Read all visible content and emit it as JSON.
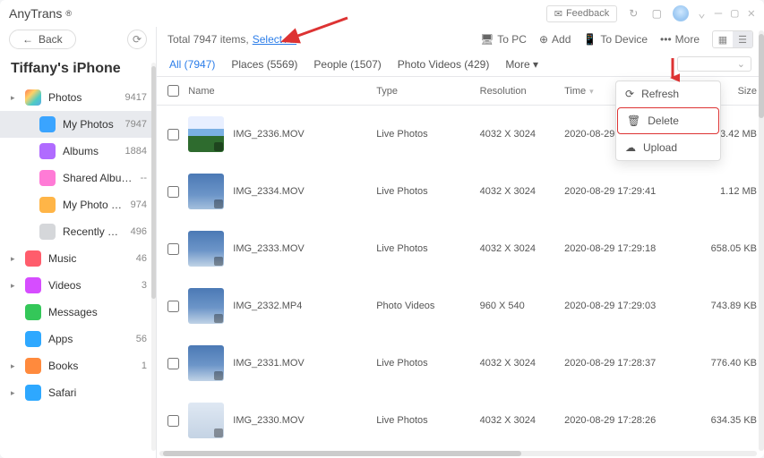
{
  "app": {
    "name": "AnyTrans",
    "reg": "®"
  },
  "titlebar": {
    "feedback": "Feedback"
  },
  "sidebar": {
    "back": "Back",
    "device": "Tiffany's iPhone",
    "items": [
      {
        "label": "Photos",
        "count": "9417",
        "caret": true,
        "icon_bg": "linear-gradient(135deg,#ff7b54,#ffd166,#4ecdc4,#5aa9e6)"
      },
      {
        "label": "My Photos",
        "count": "7947",
        "child": true,
        "selected": true,
        "icon_bg": "#3aa4ff"
      },
      {
        "label": "Albums",
        "count": "1884",
        "child": true,
        "icon_bg": "#b06bff"
      },
      {
        "label": "Shared Albums",
        "count": "--",
        "child": true,
        "icon_bg": "#ff7bd6"
      },
      {
        "label": "My Photo Stream",
        "count": "974",
        "child": true,
        "icon_bg": "#ffb547"
      },
      {
        "label": "Recently Deleted",
        "count": "496",
        "child": true,
        "icon_bg": "#d5d7da"
      },
      {
        "label": "Music",
        "count": "46",
        "caret": true,
        "icon_bg": "#ff5d6c"
      },
      {
        "label": "Videos",
        "count": "3",
        "caret": true,
        "icon_bg": "#d64dff"
      },
      {
        "label": "Messages",
        "count": "",
        "icon_bg": "#34c759"
      },
      {
        "label": "Apps",
        "count": "56",
        "icon_bg": "#2ea8ff"
      },
      {
        "label": "Books",
        "count": "1",
        "caret": true,
        "icon_bg": "#ff8a3d"
      },
      {
        "label": "Safari",
        "count": "",
        "caret": true,
        "icon_bg": "#2ea8ff"
      }
    ]
  },
  "toolbar": {
    "total_pre": "Total 7947 items, ",
    "select_all": "Select All",
    "to_pc": "To PC",
    "add": "Add",
    "to_device": "To Device",
    "more": "More"
  },
  "tabs": [
    {
      "label": "All",
      "count": "(7947)",
      "active": true
    },
    {
      "label": "Places",
      "count": "(5569)"
    },
    {
      "label": "People",
      "count": "(1507)"
    },
    {
      "label": "Photo Videos",
      "count": "(429)"
    },
    {
      "label": "More",
      "count": "▾"
    }
  ],
  "columns": {
    "name": "Name",
    "type": "Type",
    "resolution": "Resolution",
    "time": "Time",
    "size": "Size"
  },
  "rows": [
    {
      "name": "IMG_2336.MOV",
      "type": "Live Photos",
      "res": "4032 X 3024",
      "time": "2020-08-29 18:24:41",
      "size": "3.42 MB",
      "thumb": "linear-gradient(#e8efff 0 35%, #7bb0e3 35% 55%, #2e6b2e 55% 100%)"
    },
    {
      "name": "IMG_2334.MOV",
      "type": "Live Photos",
      "res": "4032 X 3024",
      "time": "2020-08-29 17:29:41",
      "size": "1.12 MB",
      "thumb": "linear-gradient(#4b79b5,#6c95c8 60%, #a4c0dd)"
    },
    {
      "name": "IMG_2333.MOV",
      "type": "Live Photos",
      "res": "4032 X 3024",
      "time": "2020-08-29 17:29:18",
      "size": "658.05 KB",
      "thumb": "linear-gradient(#4b79b5,#6c95c8 55%, #c0d3e6)"
    },
    {
      "name": "IMG_2332.MP4",
      "type": "Photo Videos",
      "res": "960 X 540",
      "time": "2020-08-29 17:29:03",
      "size": "743.89 KB",
      "thumb": "linear-gradient(#4b79b5,#6c95c8 55%, #c0d3e6)"
    },
    {
      "name": "IMG_2331.MOV",
      "type": "Live Photos",
      "res": "4032 X 3024",
      "time": "2020-08-29 17:28:37",
      "size": "776.40 KB",
      "thumb": "linear-gradient(#4b79b5,#6c95c8 55%, #c0d3e6)"
    },
    {
      "name": "IMG_2330.MOV",
      "type": "Live Photos",
      "res": "4032 X 3024",
      "time": "2020-08-29 17:28:26",
      "size": "634.35 KB",
      "thumb": "linear-gradient(#dfe8f3,#c4d3e4)"
    }
  ],
  "more_menu": {
    "refresh": "Refresh",
    "delete": "Delete",
    "upload": "Upload"
  }
}
